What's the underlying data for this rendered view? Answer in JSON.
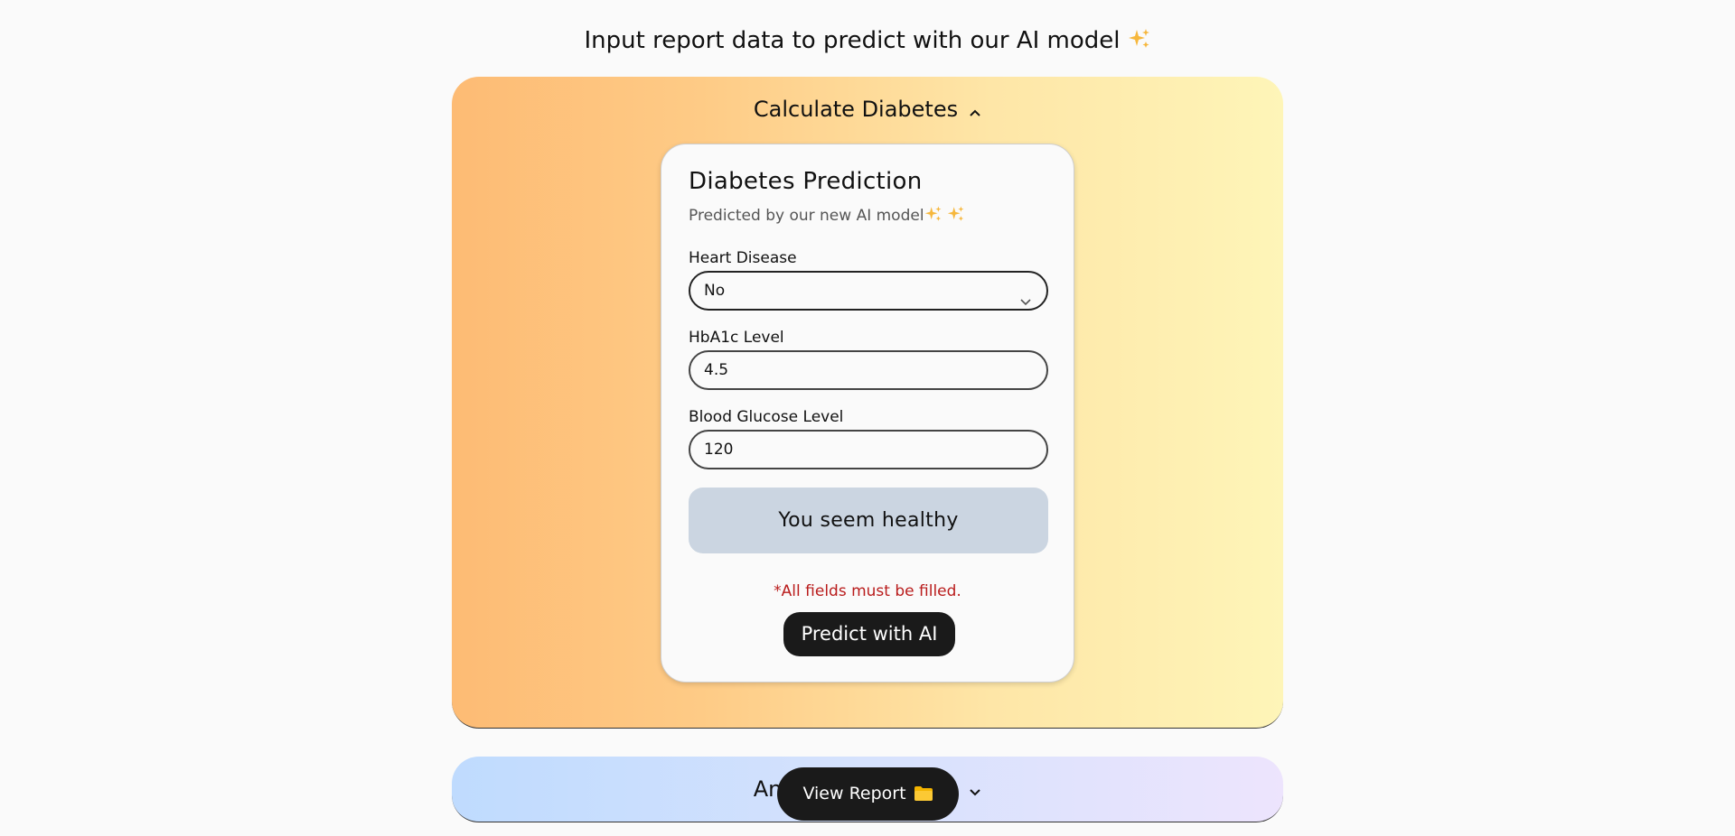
{
  "page": {
    "heading": "Input report data to predict with our AI model",
    "heading_icon": "sparkles-icon"
  },
  "calculate_panel": {
    "title": "Calculate Diabetes",
    "expanded": true,
    "gradient": [
      "#fdbb74",
      "#fef5b8"
    ]
  },
  "card": {
    "title": "Diabetes Prediction",
    "subtitle": "Predicted by our new AI model",
    "subtitle_icons": [
      "sparkles-icon",
      "sparkles-icon"
    ],
    "fields": [
      {
        "label": "Heart Disease",
        "type": "select",
        "value": "No"
      },
      {
        "label": "HbA1c Level",
        "type": "input",
        "value": "4.5"
      },
      {
        "label": "Blood Glucose Level",
        "type": "input",
        "value": "120"
      }
    ],
    "result": "You seem healthy",
    "warning": "*All fields must be filled.",
    "predict_button": "Predict with AI"
  },
  "analysis_panel": {
    "title": "Ana",
    "title_rest": "n",
    "expanded": false,
    "gradient": [
      "#bfdbfe",
      "#ede4fd"
    ]
  },
  "view_report": {
    "label": "View Report",
    "icon": "folder-icon"
  },
  "colors": {
    "accent_dark": "#1a1a1a",
    "warning": "#b91c1c",
    "result_bg": "#cbd5e1"
  }
}
